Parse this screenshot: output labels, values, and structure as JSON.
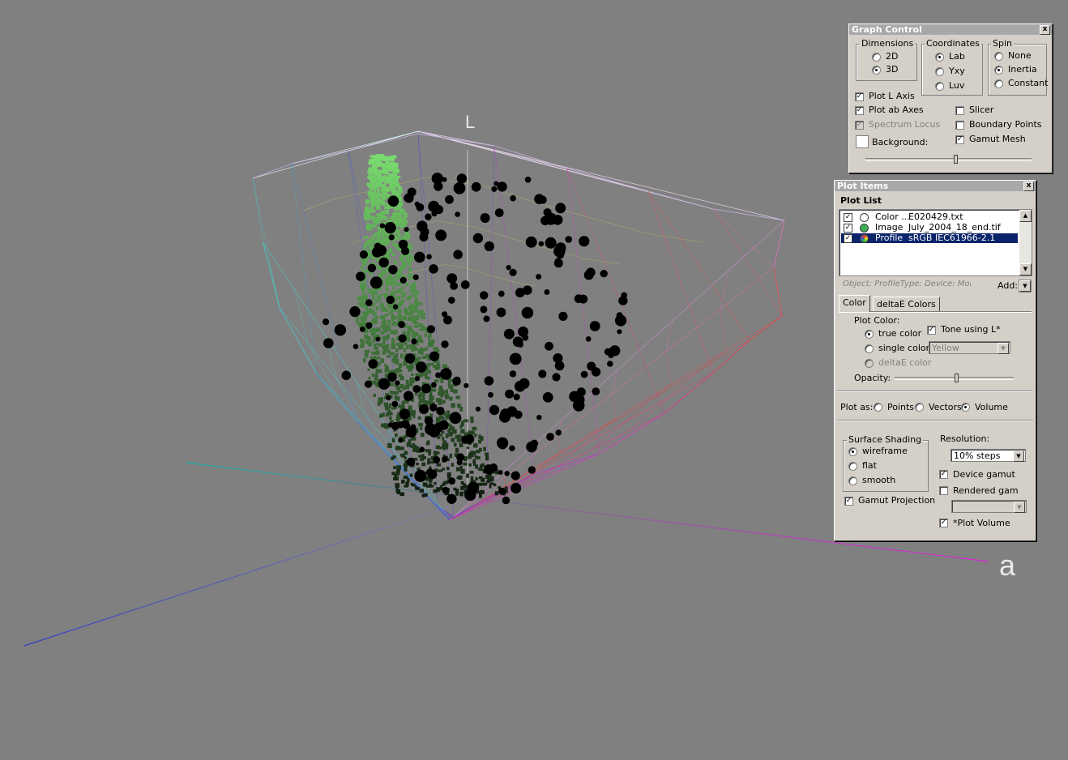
{
  "viewport": {
    "axis_labels": {
      "l": "L",
      "a": "a"
    }
  },
  "graph_control": {
    "title": "Graph Control",
    "close_label": "x",
    "dimensions": {
      "legend": "Dimensions",
      "options": [
        "2D",
        "3D"
      ],
      "selected": "3D"
    },
    "coordinates": {
      "legend": "Coordinates",
      "options": [
        "Lab",
        "Yxy",
        "Luv"
      ],
      "selected": "Lab"
    },
    "spin": {
      "legend": "Spin",
      "options": [
        "None",
        "Inertia",
        "Constant"
      ],
      "selected": "Inertia"
    },
    "checks": {
      "plot_l_axis": "Plot L Axis",
      "plot_ab_axes": "Plot ab Axes",
      "spectrum_locus": "Spectrum Locus",
      "slicer": "Slicer",
      "boundary_points": "Boundary Points",
      "gamut_mesh": "Gamut Mesh"
    },
    "checked": {
      "plot_l_axis": true,
      "plot_ab_axes": true,
      "spectrum_locus": true,
      "slicer": false,
      "boundary_points": false,
      "gamut_mesh": true
    },
    "background_label": "Background:",
    "background_color": "#ffffff",
    "slider_value": 0.53
  },
  "plot_items": {
    "title": "Plot Items",
    "close_label": "x",
    "list_title": "Plot List",
    "rows": [
      {
        "kind": "Color ...",
        "name": "E020429.txt",
        "checked": true,
        "swatch": "hollow"
      },
      {
        "kind": "Image",
        "name": "July_2004_18_end.tif",
        "checked": true,
        "swatch": "#3fae57"
      },
      {
        "kind": "Profile",
        "name": "sRGB IEC61966-2.1",
        "checked": true,
        "swatch": "multi"
      }
    ],
    "selected_row": 2,
    "object_info": "Object: ProfileType: Device: MonitorDa",
    "add_label": "Add:",
    "tabs": [
      "Color",
      "deltaE Colors"
    ],
    "active_tab": "Color",
    "plot_color_label": "Plot Color:",
    "plot_color_options": [
      "true color",
      "single color:",
      "deltaE color"
    ],
    "plot_color_selected": "true color",
    "tone_using_l": "Tone using L*",
    "tone_using_l_checked": true,
    "single_color_value": "Yellow",
    "opacity_label": "Opacity:",
    "opacity_value": 0.5,
    "plot_as_label": "Plot as:",
    "plot_as_options": [
      "Points",
      "Vectors",
      "Volume"
    ],
    "plot_as_selected": "Volume",
    "surface_shading": {
      "legend": "Surface Shading",
      "options": [
        "wireframe",
        "flat",
        "smooth"
      ],
      "selected": "wireframe"
    },
    "gamut_projection": "Gamut Projection",
    "gamut_projection_checked": true,
    "resolution_label": "Resolution:",
    "resolution_value": "10% steps",
    "device_gamut": "Device gamut",
    "device_gamut_checked": true,
    "rendered_gamut": "Rendered gamut",
    "rendered_gamut_checked": false,
    "rendered_gamut_value": "",
    "plot_volume": "*Plot Volume",
    "plot_volume_checked": true
  }
}
